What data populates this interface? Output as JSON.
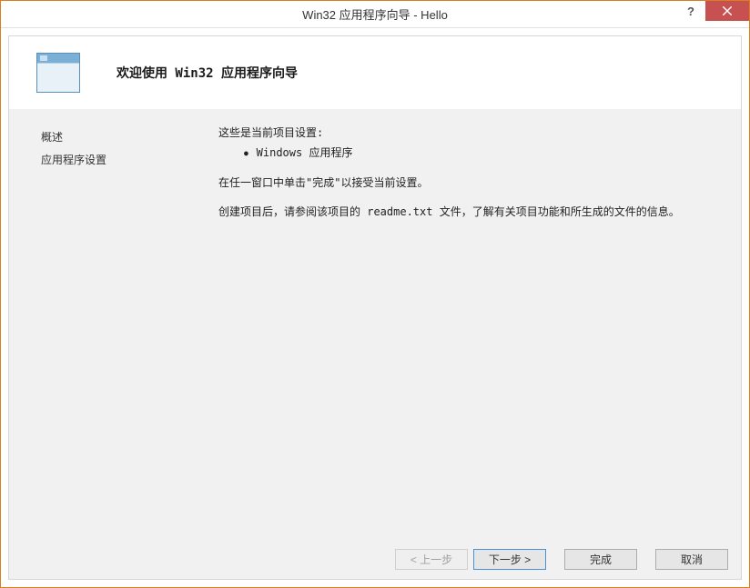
{
  "window": {
    "title": "Win32 应用程序向导 - Hello"
  },
  "header": {
    "title": "欢迎使用 Win32 应用程序向导"
  },
  "sidebar": {
    "items": [
      {
        "label": "概述"
      },
      {
        "label": "应用程序设置"
      }
    ]
  },
  "main": {
    "intro": "这些是当前项目设置:",
    "bullets": [
      "Windows 应用程序"
    ],
    "para1": "在任一窗口中单击\"完成\"以接受当前设置。",
    "para2": "创建项目后，请参阅该项目的 readme.txt 文件，了解有关项目功能和所生成的文件的信息。"
  },
  "buttons": {
    "prev": "< 上一步",
    "next": "下一步 >",
    "finish": "完成",
    "cancel": "取消"
  }
}
